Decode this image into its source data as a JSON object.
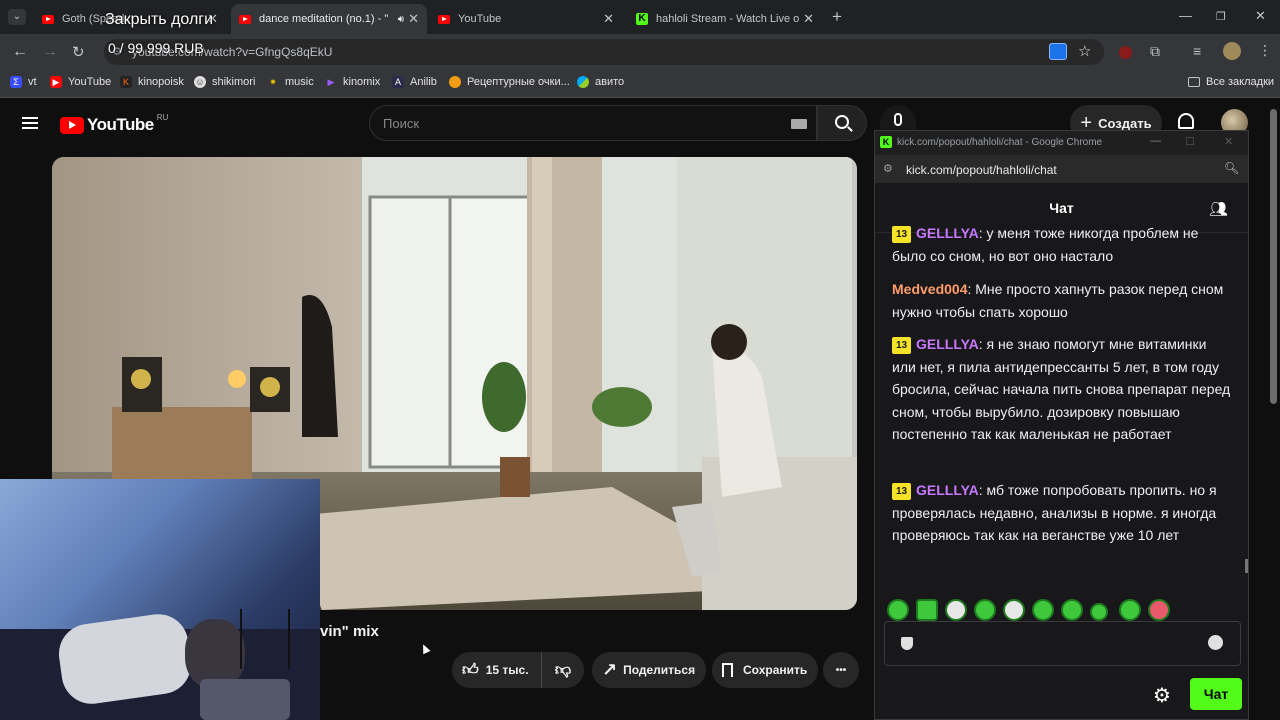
{
  "overlay": {
    "title": "Закрыть долги",
    "amount": "0 / 99 999 RUB"
  },
  "browser": {
    "tabs": [
      {
        "title": "Goth (Speed",
        "close": "✕"
      },
      {
        "title": "dance meditation (no.1) - \"",
        "close": "✕"
      },
      {
        "title": "YouTube",
        "close": "✕"
      },
      {
        "title": "hahloli Stream - Watch Live on",
        "close": "✕"
      }
    ],
    "new_tab": "+",
    "url": "youtube.com/watch?v=GfngQs8qEkU",
    "bookmarks": [
      "vt",
      "YouTube",
      "kinopoisk",
      "shikimori",
      "music",
      "kinomix",
      "Anilib",
      "Рецептурные очки...",
      "авито"
    ],
    "all_bookmarks": "Все закладки"
  },
  "youtube": {
    "logo": "YouTube",
    "region": "RU",
    "search_placeholder": "Поиск",
    "create_label": "Создать",
    "video_title_partial": "vin\" mix",
    "like_count": "15 тыс.",
    "share_label": "Поделиться",
    "save_label": "Сохранить",
    "more_label": "•••"
  },
  "popup": {
    "window_title": "kick.com/popout/hahloli/chat - Google Chrome",
    "url": "kick.com/popout/hahloli/chat",
    "header": "Чат",
    "messages": [
      {
        "badge": "13",
        "user": "GELLLYA",
        "user_color": "#c678ff",
        "text": "у меня тоже никогда проблем не было со сном, но вот оно настало"
      },
      {
        "badge": "",
        "user": "Medved004",
        "user_color": "#ff9e6b",
        "text": "Мне просто хапнуть разок перед сном нужно чтобы спать хорошо"
      },
      {
        "badge": "13",
        "user": "GELLLYA",
        "user_color": "#c678ff",
        "text": "я не знаю помогут мне витаминки или нет, я пила антидепрессанты 5 лет, в том году бросила, сейчас начала пить снова препарат перед сном, чтобы вырубило. дозировку повышаю постепенно так как маленькая не работает"
      },
      {
        "badge": "13",
        "user": "GELLLYA",
        "user_color": "#c678ff",
        "text": "мб тоже попробовать пропить. но я проверялась недавно, анализы в норме. я иногда проверяюсь так как на веганстве уже 10 лет"
      }
    ],
    "send_label": "Чат",
    "accent": "#53fc18"
  }
}
